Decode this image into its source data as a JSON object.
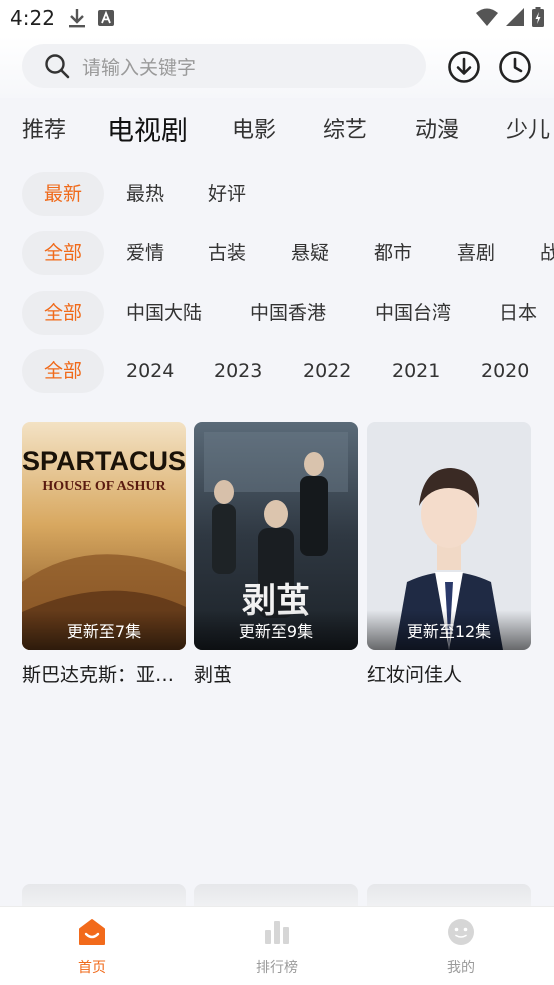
{
  "status_bar": {
    "time": "4:22"
  },
  "search": {
    "placeholder": "请输入关键字"
  },
  "category_tabs": [
    {
      "label": "推荐",
      "active": false
    },
    {
      "label": "电视剧",
      "active": true
    },
    {
      "label": "电影",
      "active": false
    },
    {
      "label": "综艺",
      "active": false
    },
    {
      "label": "动漫",
      "active": false
    },
    {
      "label": "少儿",
      "active": false
    }
  ],
  "filters": {
    "sort": [
      "最新",
      "最热",
      "好评"
    ],
    "genre": [
      "全部",
      "爱情",
      "古装",
      "悬疑",
      "都市",
      "喜剧",
      "战"
    ],
    "region": [
      "全部",
      "中国大陆",
      "中国香港",
      "中国台湾",
      "日本"
    ],
    "year": [
      "全部",
      "2024",
      "2023",
      "2022",
      "2021",
      "2020"
    ]
  },
  "cards": [
    {
      "title": "斯巴达克斯：亚…",
      "badge": "更新至7集",
      "poster_text": [
        "SPARTACUS",
        "HOUSE OF ASHUR"
      ]
    },
    {
      "title": "剥茧",
      "badge": "更新至9集",
      "poster_text": [
        "剥茧"
      ]
    },
    {
      "title": "红妆问佳人",
      "badge": "更新至12集",
      "poster_text": []
    }
  ],
  "bottom_nav": [
    {
      "label": "首页",
      "icon": "home-icon",
      "active": true
    },
    {
      "label": "排行榜",
      "icon": "ranking-icon",
      "active": false
    },
    {
      "label": "我的",
      "icon": "profile-icon",
      "active": false
    }
  ],
  "colors": {
    "accent": "#f06a1a",
    "background": "#f4f5f9"
  }
}
